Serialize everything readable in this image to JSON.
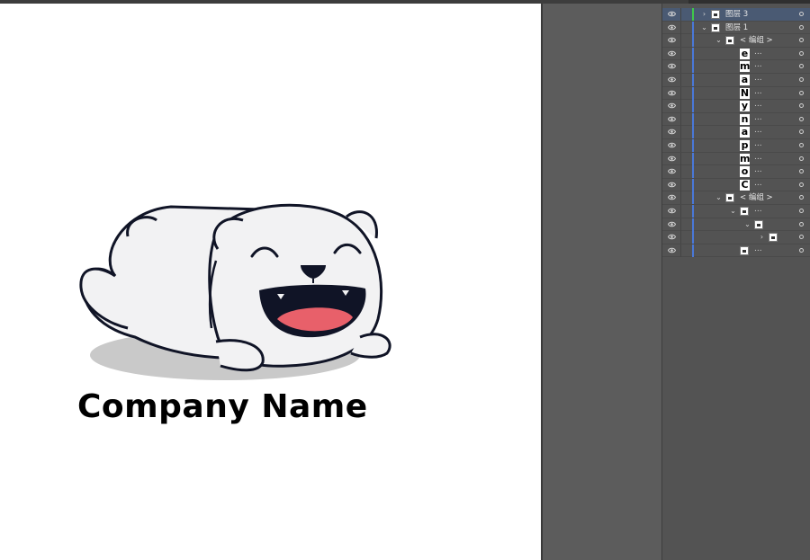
{
  "canvas": {
    "company_name": "Company Name"
  },
  "layers": [
    {
      "kind": "layer",
      "label": "图层 3",
      "expanded": false,
      "selected": true,
      "color": "#3fc84a",
      "depth": 0
    },
    {
      "kind": "layer",
      "label": "图层 1",
      "expanded": true,
      "selected": false,
      "color": "#4a78d8",
      "depth": 0
    },
    {
      "kind": "group",
      "label": "< 编组 >",
      "expanded": true,
      "depth": 1
    },
    {
      "kind": "glyph",
      "glyph": "e",
      "dots": "...",
      "depth": 2
    },
    {
      "kind": "glyph",
      "glyph": "m",
      "dots": "...",
      "depth": 2
    },
    {
      "kind": "glyph",
      "glyph": "a",
      "dots": "...",
      "depth": 2
    },
    {
      "kind": "glyph",
      "glyph": "N",
      "dots": "...",
      "depth": 2
    },
    {
      "kind": "glyph",
      "glyph": "y",
      "dots": "...",
      "depth": 2
    },
    {
      "kind": "glyph",
      "glyph": "n",
      "dots": "...",
      "depth": 2
    },
    {
      "kind": "glyph",
      "glyph": "a",
      "dots": "...",
      "depth": 2
    },
    {
      "kind": "glyph",
      "glyph": "p",
      "dots": "...",
      "depth": 2
    },
    {
      "kind": "glyph",
      "glyph": "m",
      "dots": "...",
      "depth": 2
    },
    {
      "kind": "glyph",
      "glyph": "o",
      "dots": "...",
      "depth": 2
    },
    {
      "kind": "glyph",
      "glyph": "C",
      "dots": "...",
      "depth": 2
    },
    {
      "kind": "group",
      "label": "< 编组 >",
      "expanded": true,
      "depth": 1
    },
    {
      "kind": "item",
      "dots": "...",
      "expanded": true,
      "depth": 2
    },
    {
      "kind": "item",
      "dots": "",
      "expanded": true,
      "depth": 3
    },
    {
      "kind": "item",
      "dots": "",
      "expanded": false,
      "depth": 4
    },
    {
      "kind": "item",
      "dots": "...",
      "depth": 2
    }
  ],
  "colors": {
    "bear_fill": "#f2f2f3",
    "bear_outline": "#101426",
    "tongue": "#e8606a",
    "shadow": "#c9c9c9"
  }
}
